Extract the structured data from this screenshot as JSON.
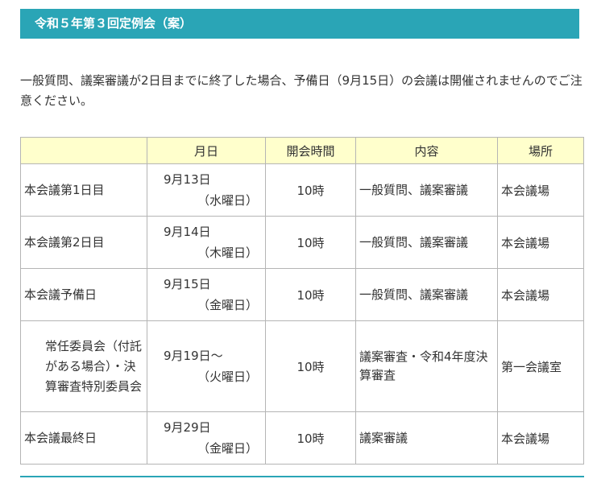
{
  "title": "令和５年第３回定例会（案）",
  "notice": "一般質問、議案審議が2日目までに終了した場合、予備日（9月15日）の会議は開催されませんのでご注意ください。",
  "table": {
    "headers": {
      "blank": "",
      "date": "月日",
      "time": "開会時間",
      "content": "内容",
      "place": "場所"
    },
    "rows": [
      {
        "event": "本会議第1日目",
        "date": "9月13日",
        "weekday": "（水曜日）",
        "time": "10時",
        "content": "一般質問、議案審議",
        "place": "本会議場"
      },
      {
        "event": "本会議第2日目",
        "date": "9月14日",
        "weekday": "（木曜日）",
        "time": "10時",
        "content": "一般質問、議案審議",
        "place": "本会議場"
      },
      {
        "event": "本会議予備日",
        "date": "9月15日",
        "weekday": "（金曜日）",
        "time": "10時",
        "content": "一般質問、議案審議",
        "place": "本会議場"
      },
      {
        "event": "常任委員会（付託がある場合）・決算審査特別委員会",
        "date": "9月19日～",
        "weekday": "（火曜日）",
        "time": "10時",
        "content": "議案審査・令和4年度決算審査",
        "place": "第一会議室"
      },
      {
        "event": "本会議最終日",
        "date": "9月29日",
        "weekday": "（金曜日）",
        "time": "10時",
        "content": "議案審議",
        "place": "本会議場"
      }
    ]
  }
}
